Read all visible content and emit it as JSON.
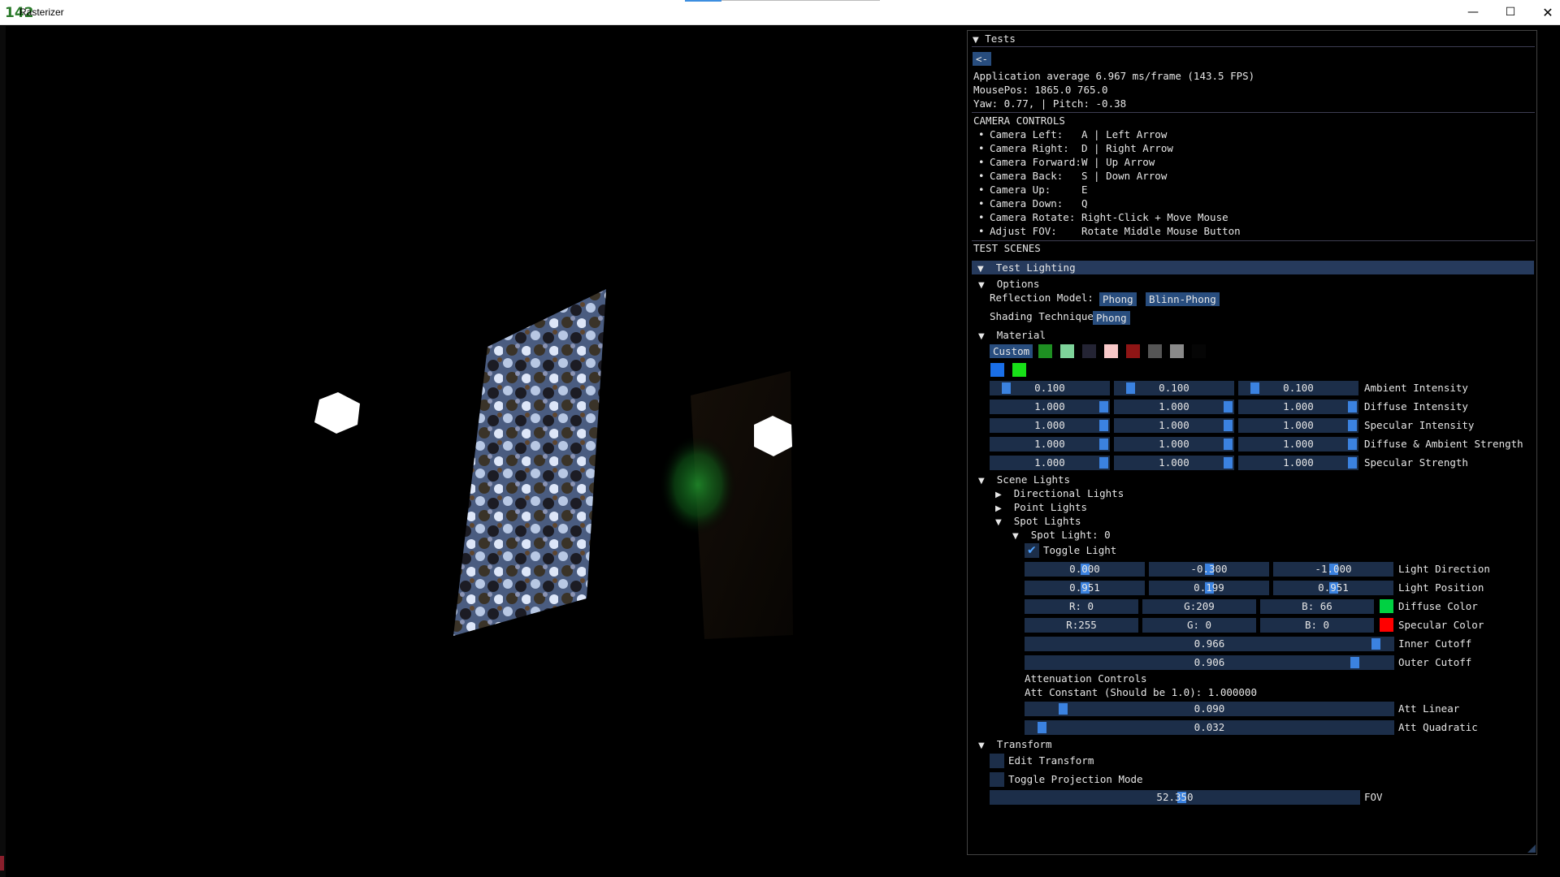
{
  "window": {
    "icon_text": "142",
    "title": "Rasterizer",
    "min": "—",
    "max": "☐",
    "close": "✕"
  },
  "panel": {
    "title": "Tests",
    "back_button": "<-",
    "stats": {
      "fps": "Application average 6.967 ms/frame (143.5 FPS)",
      "mouse": "MousePos: 1865.0 765.0",
      "yaw": "Yaw: 0.77, | Pitch: -0.38"
    },
    "camera_heading": "CAMERA CONTROLS",
    "camera_controls": [
      {
        "key": "Camera Left:",
        "val": "A | Left Arrow"
      },
      {
        "key": "Camera Right:",
        "val": "D | Right Arrow"
      },
      {
        "key": "Camera Forward:",
        "val": "W | Up Arrow"
      },
      {
        "key": "Camera Back:",
        "val": "S | Down Arrow"
      },
      {
        "key": "Camera Up:",
        "val": "E"
      },
      {
        "key": "Camera Down:",
        "val": "Q"
      },
      {
        "key": "Camera Rotate:",
        "val": "Right-Click + Move Mouse"
      },
      {
        "key": "Adjust FOV:",
        "val": "Rotate Middle Mouse Button"
      }
    ],
    "scenes_heading": "TEST SCENES",
    "scene": "Test Lighting",
    "options": {
      "label": "Options",
      "reflection_label": "Reflection Model:",
      "reflection_opts": [
        "Phong",
        "Blinn-Phong"
      ],
      "shading_label": "Shading Technique",
      "shading_opt": "Phong"
    },
    "material": {
      "label": "Material",
      "custom": "Custom",
      "swatches": [
        "#1e8f22",
        "#7ed39a",
        "#242434",
        "#f8c8c8",
        "#8f1515",
        "#555555",
        "#8a8a8a",
        "#050505",
        "#1a6fe8",
        "#18e018"
      ],
      "rows": [
        {
          "vals": [
            "0.100",
            "0.100",
            "0.100"
          ],
          "label": "Ambient Intensity",
          "grab": [
            0.1,
            0.1,
            0.1
          ]
        },
        {
          "vals": [
            "1.000",
            "1.000",
            "1.000"
          ],
          "label": "Diffuse Intensity",
          "grab": [
            1,
            1,
            1
          ]
        },
        {
          "vals": [
            "1.000",
            "1.000",
            "1.000"
          ],
          "label": "Specular Intensity",
          "grab": [
            1,
            1,
            1
          ]
        },
        {
          "vals": [
            "1.000",
            "1.000",
            "1.000"
          ],
          "label": "Diffuse & Ambient Strength",
          "grab": [
            1,
            1,
            1
          ]
        },
        {
          "vals": [
            "1.000",
            "1.000",
            "1.000"
          ],
          "label": "Specular Strength",
          "grab": [
            1,
            1,
            1
          ]
        }
      ]
    },
    "lights": {
      "label": "Scene Lights",
      "directional": "Directional Lights",
      "point": "Point Lights",
      "spot": "Spot Lights",
      "spot0": "Spot Light: 0",
      "toggle": "Toggle Light",
      "direction": {
        "vals": [
          "0.000",
          "-0.300",
          "-1.000"
        ],
        "label": "Light Direction",
        "grab": [
          0.5,
          0.5,
          0.5
        ]
      },
      "position": {
        "vals": [
          "0.951",
          "0.199",
          "0.951"
        ],
        "label": "Light Position",
        "grab": [
          0.5,
          0.5,
          0.5
        ]
      },
      "diffuse": {
        "vals": [
          "R:  0",
          "G:209",
          "B: 66"
        ],
        "label": "Diffuse Color",
        "color": "#00d142"
      },
      "specular": {
        "vals": [
          "R:255",
          "G:  0",
          "B:  0"
        ],
        "label": "Specular Color",
        "color": "#ff0000"
      },
      "inner": {
        "val": "0.966",
        "label": "Inner Cutoff",
        "grab": 0.966
      },
      "outer": {
        "val": "0.906",
        "label": "Outer Cutoff",
        "grab": 0.906
      },
      "att_heading": "Attenuation Controls",
      "att_constant": "Att Constant (Should be 1.0): 1.000000",
      "att_linear": {
        "val": "0.090",
        "label": "Att Linear",
        "grab": 0.09
      },
      "att_quadratic": {
        "val": "0.032",
        "label": "Att Quadratic",
        "grab": 0.032
      }
    },
    "transform": {
      "label": "Transform",
      "edit": "Edit Transform",
      "projection": "Toggle Projection Mode",
      "fov": {
        "val": "52.350",
        "label": "FOV",
        "grab": 0.52
      }
    }
  }
}
